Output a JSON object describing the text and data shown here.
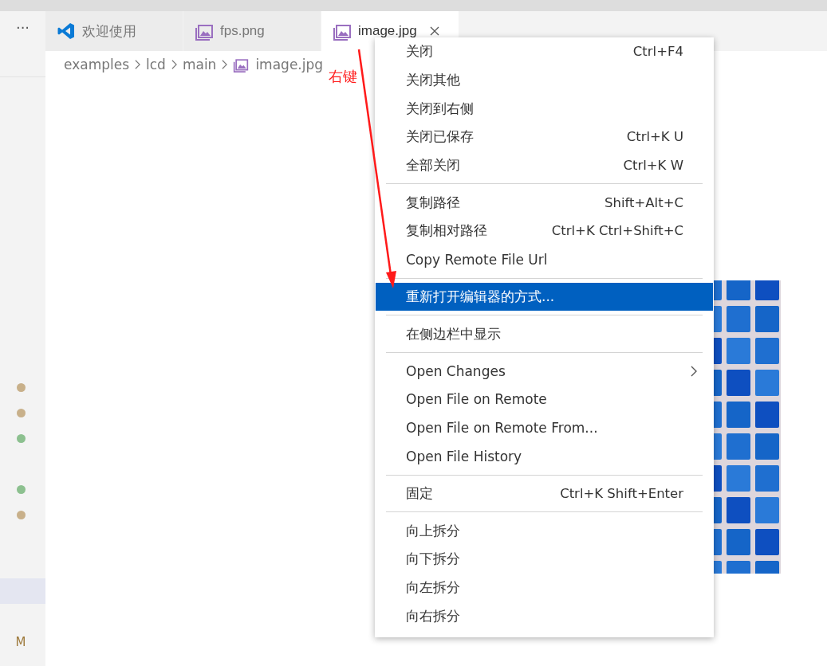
{
  "tabs": [
    {
      "label": "欢迎使用",
      "kind": "app",
      "selected": false,
      "closable": false
    },
    {
      "label": "fps.png",
      "kind": "file",
      "selected": false,
      "closable": false
    },
    {
      "label": "image.jpg",
      "kind": "file",
      "selected": true,
      "closable": true
    }
  ],
  "breadcrumb": [
    {
      "label": "examples",
      "kind": "folder"
    },
    {
      "label": "lcd",
      "kind": "folder"
    },
    {
      "label": "main",
      "kind": "folder"
    },
    {
      "label": "image.jpg",
      "kind": "file"
    }
  ],
  "sidebar": {
    "more": "···",
    "rows": [
      {
        "kind": "dot",
        "color": "#c8b08a"
      },
      {
        "kind": "dot",
        "color": "#c8b08a"
      },
      {
        "kind": "dot",
        "color": "#8cc08f"
      },
      {
        "kind": "blank"
      },
      {
        "kind": "dot",
        "color": "#8cc08f"
      },
      {
        "kind": "dot",
        "color": "#c8b08a"
      },
      {
        "kind": "blank"
      },
      {
        "kind": "blank"
      },
      {
        "kind": "highlight"
      },
      {
        "kind": "blank"
      },
      {
        "kind": "letter",
        "text": "M"
      }
    ]
  },
  "annotation": {
    "text": "右键"
  },
  "context_menu": {
    "groups": [
      [
        {
          "label": "关闭",
          "shortcut": "Ctrl+F4",
          "selected": false,
          "submenu": false
        },
        {
          "label": "关闭其他",
          "selected": false,
          "submenu": false
        },
        {
          "label": "关闭到右侧",
          "selected": false,
          "submenu": false
        },
        {
          "label": "关闭已保存",
          "shortcut": "Ctrl+K U",
          "selected": false,
          "submenu": false
        },
        {
          "label": "全部关闭",
          "shortcut": "Ctrl+K W",
          "selected": false,
          "submenu": false
        }
      ],
      [
        {
          "label": "复制路径",
          "shortcut": "Shift+Alt+C",
          "selected": false,
          "submenu": false
        },
        {
          "label": "复制相对路径",
          "shortcut": "Ctrl+K Ctrl+Shift+C",
          "selected": false,
          "submenu": false
        },
        {
          "label": "Copy Remote File Url",
          "selected": false,
          "submenu": false
        }
      ],
      [
        {
          "label": "重新打开编辑器的方式...",
          "selected": true,
          "submenu": false
        }
      ],
      [
        {
          "label": "在侧边栏中显示",
          "selected": false,
          "submenu": false
        }
      ],
      [
        {
          "label": "Open Changes",
          "selected": false,
          "submenu": true
        },
        {
          "label": "Open File on Remote",
          "selected": false,
          "submenu": false
        },
        {
          "label": "Open File on Remote From...",
          "selected": false,
          "submenu": false
        },
        {
          "label": "Open File History",
          "selected": false,
          "submenu": false
        }
      ],
      [
        {
          "label": "固定",
          "shortcut": "Ctrl+K Shift+Enter",
          "selected": false,
          "submenu": false
        }
      ],
      [
        {
          "label": "向上拆分",
          "selected": false,
          "submenu": false
        },
        {
          "label": "向下拆分",
          "selected": false,
          "submenu": false
        },
        {
          "label": "向左拆分",
          "selected": false,
          "submenu": false
        },
        {
          "label": "向右拆分",
          "selected": false,
          "submenu": false
        }
      ]
    ]
  }
}
